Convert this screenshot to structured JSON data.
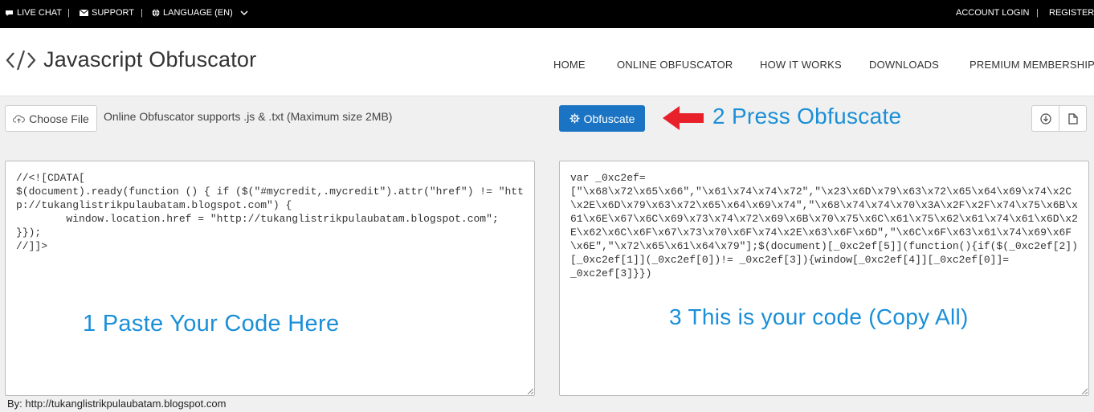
{
  "topbar": {
    "live_chat": "LIVE CHAT",
    "support": "SUPPORT",
    "language": "LANGUAGE (EN)",
    "account_login": "ACCOUNT LOGIN",
    "register": "REGISTER",
    "separator": "|"
  },
  "header": {
    "logo_text": "Javascript Obfuscator",
    "nav": [
      "HOME",
      "ONLINE OBFUSCATOR",
      "HOW IT WORKS",
      "DOWNLOADS",
      "PREMIUM MEMBERSHIP"
    ]
  },
  "toolbar": {
    "choose_file": "Choose File",
    "support_text": "Online Obfuscator supports .js & .txt (Maximum size 2MB)",
    "obfuscate": "Obfuscate"
  },
  "annotations": {
    "step1": "1   Paste Your Code Here",
    "step2": "2  Press Obfuscate",
    "step3": "3  This is your code (Copy All)"
  },
  "input_code": "//<![CDATA[\n$(document).ready(function () { if ($(\"#mycredit,.mycredit\").attr(\"href\") != \"http://tukanglistrikpulaubatam.blogspot.com\") {\n        window.location.href = \"http://tukanglistrikpulaubatam.blogspot.com\";\n}});\n//]]>",
  "output_code": "var _0xc2ef=\n[\"\\x68\\x72\\x65\\x66\",\"\\x61\\x74\\x74\\x72\",\"\\x23\\x6D\\x79\\x63\\x72\\x65\\x64\\x69\\x74\\x2C\\x2E\\x6D\\x79\\x63\\x72\\x65\\x64\\x69\\x74\",\"\\x68\\x74\\x74\\x70\\x3A\\x2F\\x2F\\x74\\x75\\x6B\\x61\\x6E\\x67\\x6C\\x69\\x73\\x74\\x72\\x69\\x6B\\x70\\x75\\x6C\\x61\\x75\\x62\\x61\\x74\\x61\\x6D\\x2E\\x62\\x6C\\x6F\\x67\\x73\\x70\\x6F\\x74\\x2E\\x63\\x6F\\x6D\",\"\\x6C\\x6F\\x63\\x61\\x74\\x69\\x6F\\x6E\",\"\\x72\\x65\\x61\\x64\\x79\"];$(document)[_0xc2ef[5]](function(){if($(_0xc2ef[2])\n[_0xc2ef[1]](_0xc2ef[0])!= _0xc2ef[3]){window[_0xc2ef[4]][_0xc2ef[0]]=\n_0xc2ef[3]}})",
  "footer": {
    "credit": "By: http://tukanglistrikpulaubatam.blogspot.com"
  },
  "colors": {
    "accent": "#1a74c3",
    "annotation": "#1a8fd8",
    "arrow": "#e8202a"
  }
}
